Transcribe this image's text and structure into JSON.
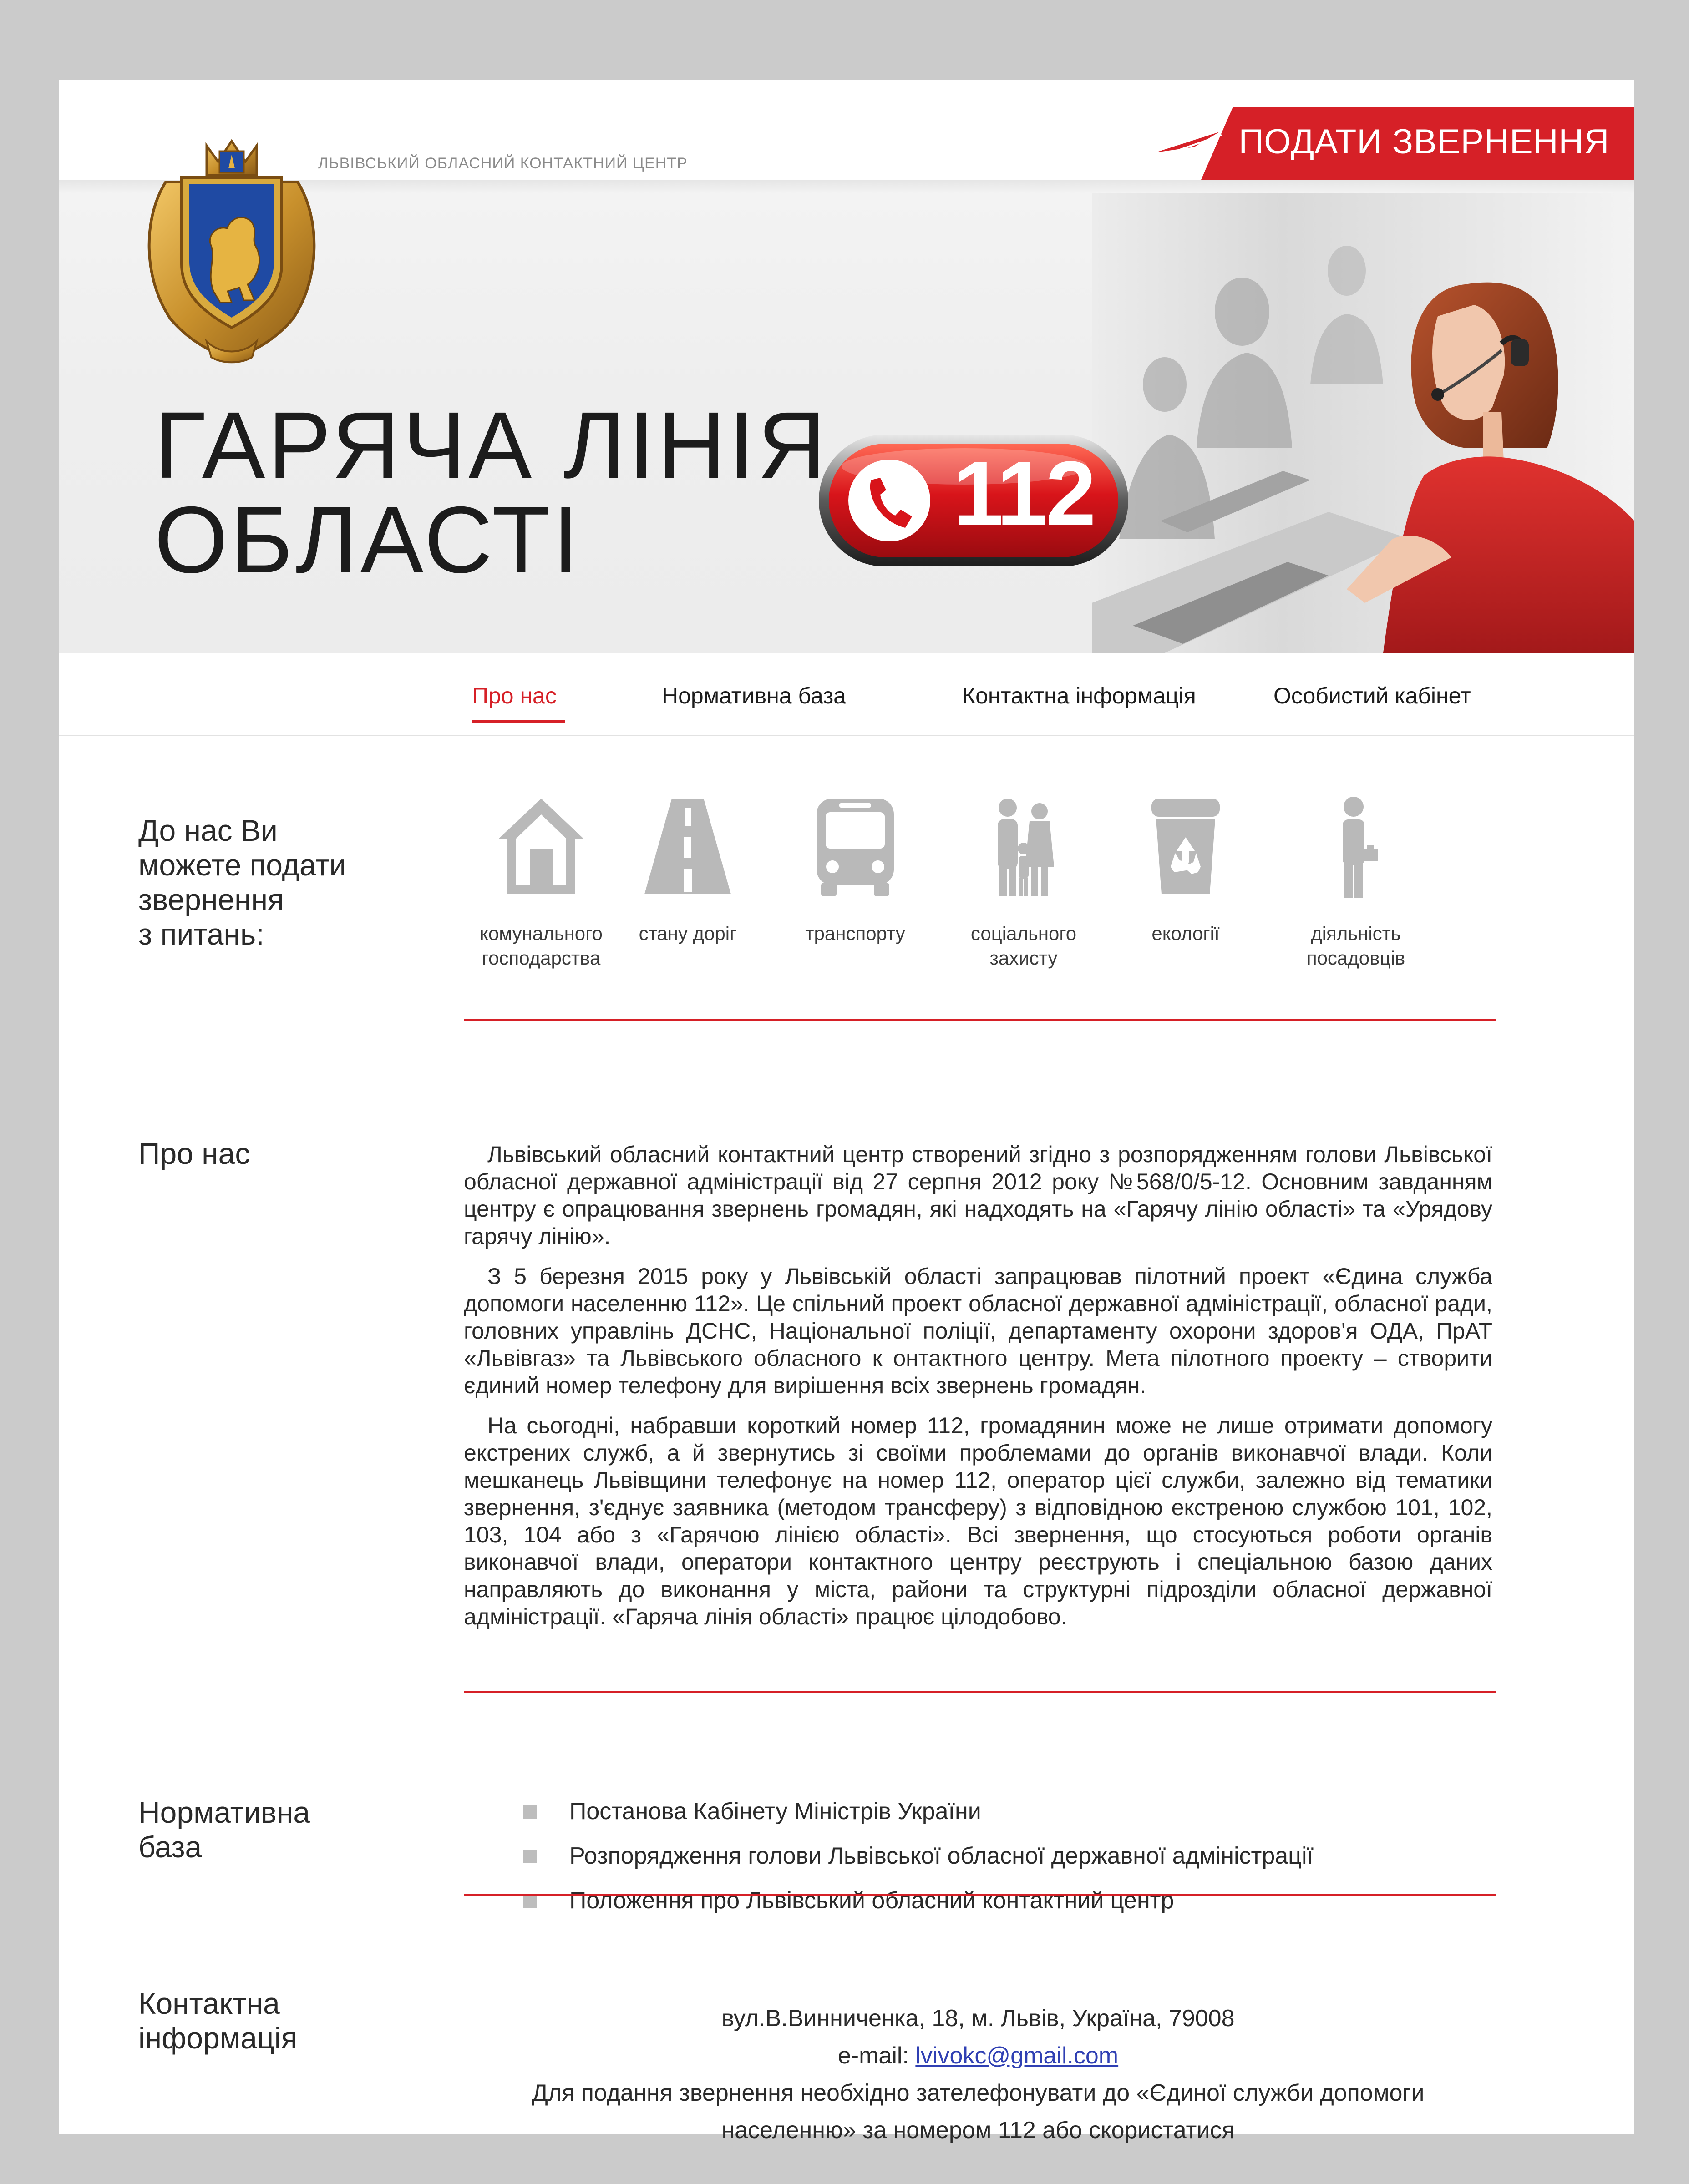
{
  "header": {
    "center_name": "ЛЬВІВСЬКИЙ ОБЛАСНИЙ КОНТАКТНИЙ ЦЕНТР",
    "submit_button": "ПОДАТИ ЗВЕРНЕННЯ",
    "title_line1": "ГАРЯЧА ЛІНІЯ",
    "title_line2": "ОБЛАСТІ",
    "badge_number": "112"
  },
  "nav": {
    "items": [
      {
        "label": "Про нас"
      },
      {
        "label": "Нормативна база"
      },
      {
        "label": "Контактна інформація"
      },
      {
        "label": "Особистий кабінет"
      }
    ],
    "active": "Про нас"
  },
  "topics": {
    "label_lines": [
      "До нас Ви",
      "можете подати",
      "звернення",
      "з питань:"
    ],
    "categories": [
      {
        "icon": "house-icon",
        "label_lines": [
          "комунального",
          "господарства"
        ]
      },
      {
        "icon": "road-icon",
        "label_lines": [
          "стану доріг"
        ]
      },
      {
        "icon": "bus-icon",
        "label_lines": [
          "транспорту"
        ]
      },
      {
        "icon": "family-icon",
        "label_lines": [
          "соціального",
          "захисту"
        ]
      },
      {
        "icon": "recycle-bin-icon",
        "label_lines": [
          "екології"
        ]
      },
      {
        "icon": "official-icon",
        "label_lines": [
          "діяльність",
          "посадовців"
        ]
      }
    ]
  },
  "about": {
    "label": "Про нас",
    "paragraphs": [
      "Львівський обласний контактний центр створений згідно з розпорядженням голови Львівської обласної державної адміністрації від 27 серпня 2012 року №568/0/5-12. Основним завданням центру є опрацювання звернень громадян, які надходять на «Гарячу лінію області» та «Урядову гарячу лінію».",
      "З 5 березня 2015 року у Львівській області запрацював пілотний проект «Єдина служба допомоги населенню 112». Це спільний проект обласної державної адміністрації, обласної ради, головних управлінь ДСНС, Національної поліції, департаменту охорони здоров'я ОДА, ПрАТ «Львівгаз» та Львівського обласного к онтактного центру. Мета пілотного проекту – створити єдиний номер телефону для вирішення всіх звернень громадян.",
      "На сьогодні, набравши короткий номер 112, громадянин може не лише отримати допомогу екстрених служб, а й звернутись зі своїми проблемами до органів виконавчої влади. Коли мешканець Львівщини телефонує на номер 112, оператор цієї служби, залежно від тематики звернення, з'єднує заявника (методом трансферу) з відповідною екстреною службою 101, 102, 103, 104 або з «Гарячою лінією області». Всі звернення, що стосуються роботи органів виконавчої влади, оператори контактного центру реєструють і спеціальною базою даних направляють до виконання у міста, райони та структурні підрозділи обласної державної адміністрації. «Гаряча лінія області» працює цілодобово."
    ]
  },
  "legal": {
    "label_lines": [
      "Нормативна",
      "база"
    ],
    "items": [
      "Постанова Кабінету Міністрів України",
      "Розпорядження голови Львівської обласної державної адміністрації",
      "Положення про Львівський обласний контактний центр"
    ]
  },
  "contacts": {
    "label_lines": [
      "Контактна",
      "інформація"
    ],
    "address": "вул.В.Винниченка, 18, м. Львів, Україна, 79008",
    "email_prefix": "e-mail: ",
    "email": "lvivokc@gmail.com",
    "note_line1": "Для подання звернення необхідно зателефонувати до «Єдиної служби допомоги",
    "note_line2": "населенню» за номером 112 або скористатися"
  },
  "colors": {
    "accent": "#d62027",
    "page_background": "#cbcbcb",
    "icon_gray": "#b9b9b9",
    "link": "#2f3fb3"
  }
}
